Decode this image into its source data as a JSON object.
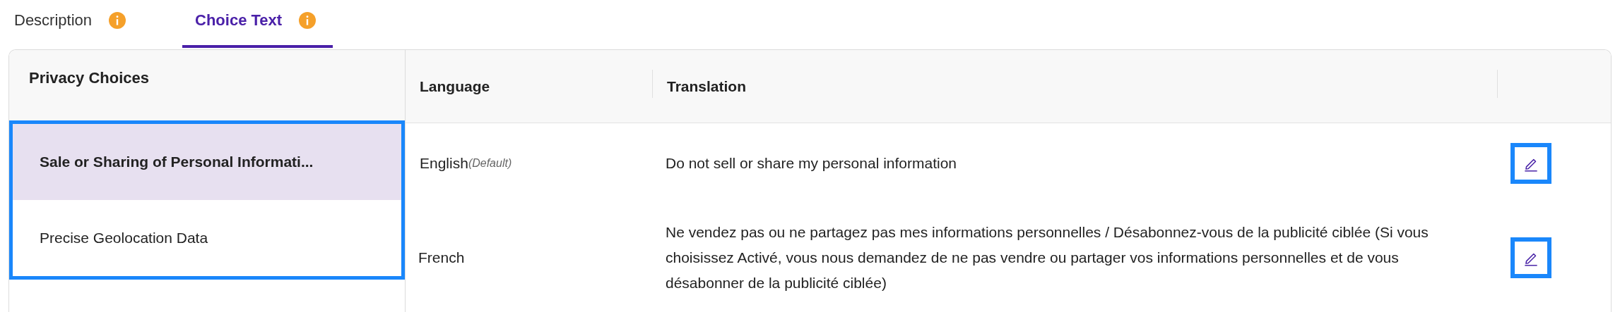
{
  "tabs": [
    {
      "label": "Description",
      "selected": false,
      "info": true
    },
    {
      "label": "Choice Text",
      "selected": true,
      "info": true
    }
  ],
  "privacy_choices": {
    "heading": "Privacy Choices",
    "highlighted": true,
    "items": [
      {
        "label": "Sale or Sharing of Personal Informati...",
        "selected": true
      },
      {
        "label": "Precise Geolocation Data",
        "selected": false
      }
    ]
  },
  "table": {
    "columns": [
      "Language",
      "Translation"
    ],
    "rows": [
      {
        "language": "English",
        "note": "(Default)",
        "translation": "Do not sell or share my personal information",
        "edit_highlighted": true
      },
      {
        "language": "French",
        "translation": "Ne vendez pas ou ne partagez pas mes informations personnelles / Désabonnez-vous de la publicité ciblée (Si vous choisissez Activé, vous nous demandez de ne pas vendre ou partager vos informations personnelles et de vous désabonner de la publicité ciblée)",
        "edit_highlighted": true
      }
    ]
  }
}
